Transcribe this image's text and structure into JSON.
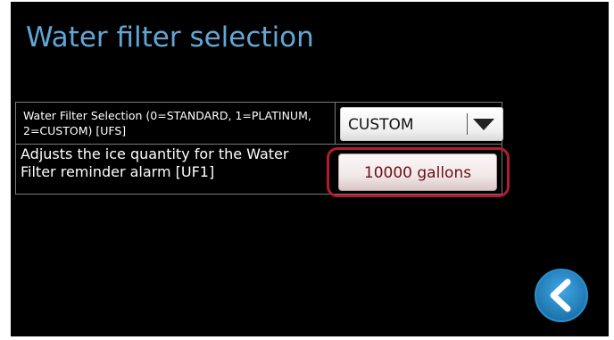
{
  "screen": {
    "title": "Water filter selection"
  },
  "settings": [
    {
      "label": "Water Filter Selection (0=STANDARD, 1=PLATINUM, 2=CUSTOM) [UFS]",
      "value": "CUSTOM",
      "control": "dropdown"
    },
    {
      "label_line1": "Adjusts the ice quantity for the Water",
      "label_line2": "Filter reminder alarm [UF1]",
      "value": "10000 gallons",
      "control": "button",
      "highlighted": true
    }
  ],
  "navigation": {
    "back_icon": "chevron-left-icon"
  },
  "colors": {
    "background": "#000000",
    "title": "#62a6d6",
    "highlight": "#b51b2c",
    "back_button": "#2a8fcf"
  }
}
